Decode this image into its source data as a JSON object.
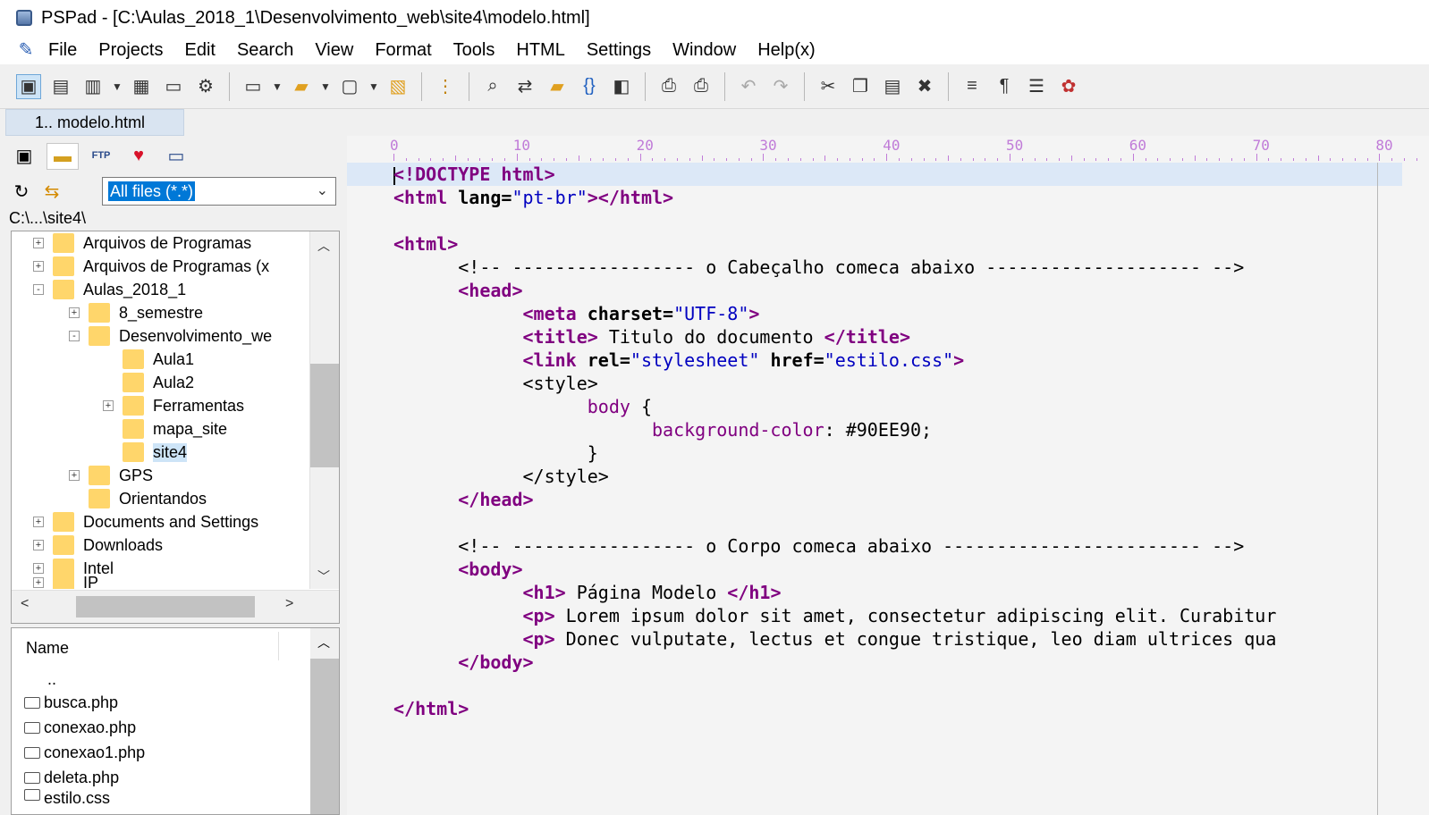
{
  "window": {
    "title": "PSPad - [C:\\Aulas_2018_1\\Desenvolvimento_web\\site4\\modelo.html]"
  },
  "menu": [
    "File",
    "Projects",
    "Edit",
    "Search",
    "View",
    "Format",
    "Tools",
    "HTML",
    "Settings",
    "Window",
    "Help(x)"
  ],
  "toolbar": {
    "icons": [
      "new-project-icon",
      "open-project-icon",
      "save-project-icon",
      "dropdown-icon",
      "project-settings-icon",
      "log-icon",
      "project-tools-icon",
      "new-file-icon",
      "dropdown-icon",
      "open-file-icon",
      "dropdown-icon",
      "save-file-icon",
      "dropdown-icon",
      "save-all-icon",
      "tree-icon",
      "find-icon",
      "replace-icon",
      "find-in-files-icon",
      "matching-bracket-icon",
      "compare-icon",
      "print-preview-icon",
      "print-icon",
      "undo-icon",
      "redo-icon",
      "cut-icon",
      "copy-icon",
      "paste-icon",
      "delete-icon",
      "wrap-icon",
      "pilcrow-icon",
      "format-icon",
      "colors-icon"
    ]
  },
  "tabs": [
    {
      "label": "1.. modelo.html"
    }
  ],
  "sidebar": {
    "tabs": [
      "projects-icon",
      "folder-icon",
      "ftp-icon",
      "favorites-heart-icon",
      "window-icon"
    ],
    "filter": {
      "value": "All files (*.*)"
    },
    "path": "C:\\...\\site4\\",
    "tree": [
      {
        "label": "Arquivos de Programas",
        "level": 0,
        "expander": "+"
      },
      {
        "label": "Arquivos de Programas (x",
        "level": 0,
        "expander": "+"
      },
      {
        "label": "Aulas_2018_1",
        "level": 0,
        "expander": "-"
      },
      {
        "label": "8_semestre",
        "level": 1,
        "expander": "+"
      },
      {
        "label": "Desenvolvimento_we",
        "level": 1,
        "expander": "-"
      },
      {
        "label": "Aula1",
        "level": 2,
        "expander": ""
      },
      {
        "label": "Aula2",
        "level": 2,
        "expander": ""
      },
      {
        "label": "Ferramentas",
        "level": 2,
        "expander": "+"
      },
      {
        "label": "mapa_site",
        "level": 2,
        "expander": ""
      },
      {
        "label": "site4",
        "level": 2,
        "expander": "",
        "selected": true
      },
      {
        "label": "GPS",
        "level": 1,
        "expander": "+"
      },
      {
        "label": "Orientandos",
        "level": 1,
        "expander": ""
      },
      {
        "label": "Documents and Settings",
        "level": 0,
        "expander": "+"
      },
      {
        "label": "Downloads",
        "level": 0,
        "expander": "+"
      },
      {
        "label": "Intel",
        "level": 0,
        "expander": "+"
      },
      {
        "label": "IP",
        "level": 0,
        "expander": "+"
      }
    ],
    "files": {
      "header": "Name",
      "items": [
        "..",
        "busca.php",
        "conexao.php",
        "conexao1.php",
        "deleta.php",
        "estilo.css"
      ]
    }
  },
  "editor": {
    "ruler": [
      "0",
      "10",
      "20",
      "30",
      "40",
      "50",
      "60",
      "70",
      "80"
    ],
    "lines": [
      [
        [
          "t",
          "<!DOCTYPE html>"
        ]
      ],
      [
        [
          "t",
          "<html "
        ],
        [
          "a",
          "lang="
        ],
        [
          "v",
          "\"pt-br\""
        ],
        [
          "t",
          "></html>"
        ]
      ],
      [],
      [
        [
          "t",
          "<html>"
        ]
      ],
      [
        [
          "c",
          "      <!-- ----------------- o Cabeçalho comeca abaixo -------------------- -->"
        ]
      ],
      [
        [
          "t",
          "      <head>"
        ]
      ],
      [
        [
          "t",
          "            <meta "
        ],
        [
          "a",
          "charset="
        ],
        [
          "v",
          "\"UTF-8\""
        ],
        [
          "t",
          ">"
        ]
      ],
      [
        [
          "t",
          "            <title>"
        ],
        [
          "c",
          " Titulo do documento "
        ],
        [
          "t",
          "</title>"
        ]
      ],
      [
        [
          "t",
          "            <link "
        ],
        [
          "a",
          "rel="
        ],
        [
          "v",
          "\"stylesheet\""
        ],
        [
          "a",
          " href="
        ],
        [
          "v",
          "\"estilo.css\""
        ],
        [
          "t",
          ">"
        ]
      ],
      [
        [
          "c",
          "            <style>"
        ]
      ],
      [
        [
          "s",
          "                  body "
        ],
        [
          "c",
          "{"
        ]
      ],
      [
        [
          "s",
          "                        background-color"
        ],
        [
          "c",
          ": #90EE90;"
        ]
      ],
      [
        [
          "c",
          "                  }"
        ]
      ],
      [
        [
          "c",
          "            </style>"
        ]
      ],
      [
        [
          "t",
          "      </head>"
        ]
      ],
      [],
      [
        [
          "c",
          "      <!-- ----------------- o Corpo comeca abaixo ------------------------ -->"
        ]
      ],
      [
        [
          "t",
          "      <body>"
        ]
      ],
      [
        [
          "t",
          "            <h1>"
        ],
        [
          "c",
          " Página Modelo "
        ],
        [
          "t",
          "</h1>"
        ]
      ],
      [
        [
          "t",
          "            <p>"
        ],
        [
          "c",
          " Lorem ipsum dolor sit amet, consectetur adipiscing elit. Curabitur"
        ]
      ],
      [
        [
          "t",
          "            <p>"
        ],
        [
          "c",
          " Donec vulputate, lectus et congue tristique, leo diam ultrices qua"
        ]
      ],
      [
        [
          "t",
          "      </body>"
        ]
      ],
      [],
      [
        [
          "t",
          "</html>"
        ]
      ]
    ]
  }
}
